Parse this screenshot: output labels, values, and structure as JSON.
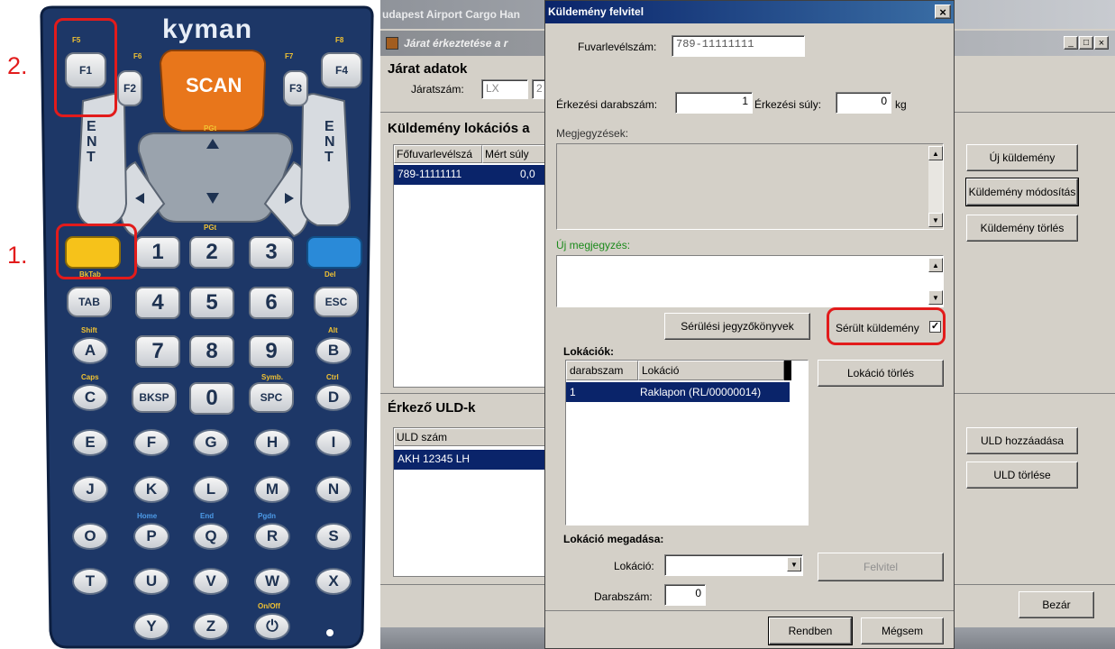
{
  "keypad": {
    "brand": "kyman",
    "annotation_1": "1.",
    "annotation_2": "2.",
    "scan_label": "SCAN",
    "fkeys": {
      "f1": "F1",
      "f2": "F2",
      "f3": "F3",
      "f4": "F4"
    },
    "fkey_small": {
      "f5": "F5",
      "f6": "F6",
      "f7": "F7",
      "f8": "F8"
    },
    "ent_label": "ENT",
    "pg_up": "PGt",
    "pg_down": "PGt",
    "num_rows": [
      [
        "1",
        "2",
        "3"
      ],
      [
        "4",
        "5",
        "6"
      ],
      [
        "7",
        "8",
        "9"
      ]
    ],
    "zero": "0",
    "tab": "TAB",
    "esc": "ESC",
    "bksp": "BKSP",
    "spc": "SPC",
    "small": {
      "bktab": "BkTab",
      "del": "Del",
      "shift": "Shift",
      "alt": "Alt",
      "caps": "Caps",
      "symb": "Symb.",
      "ctrl": "Ctrl",
      "home": "Home",
      "end": "End",
      "pgdn": "Pgdn",
      "onoff": "On/Off"
    },
    "letters": [
      [
        "A",
        "B"
      ],
      [
        "C",
        "D"
      ],
      [
        "E",
        "F",
        "G",
        "H",
        "I"
      ],
      [
        "J",
        "K",
        "L",
        "M",
        "N"
      ],
      [
        "O",
        "P",
        "Q",
        "R",
        "S"
      ],
      [
        "T",
        "U",
        "V",
        "W",
        "X"
      ],
      [
        "Y",
        "Z"
      ]
    ],
    "power": "⏻"
  },
  "colors": {
    "accent_orange": "#e8761b",
    "key_yellow": "#f6c21a",
    "key_blue": "#2a8ad8",
    "body_navy": "#1d3767",
    "selection": "#0a246a",
    "annotation_red": "#e21b1b"
  },
  "bg_window": {
    "taskbar_title": "udapest Airport Cargo Han",
    "title": "Járat érkeztetése a r",
    "section_flight": "Járat adatok",
    "flight_no_label": "Járatszám:",
    "flight_no_value": "LX",
    "flight_no_value2": "2",
    "section_locations": "Küldemény lokációs a",
    "table_headers": [
      "Főfuvarlevélszá",
      "Mért súly"
    ],
    "table_row": [
      "789-11111111",
      "0,0"
    ],
    "section_uld": "Érkező ULD-k",
    "uld_header": "ULD szám",
    "uld_row": "AKH 12345 LH",
    "btn_new": "Új küldemény",
    "btn_modify": "Küldemény módosítás",
    "btn_delete": "Küldemény törlés",
    "btn_uld_add": "ULD hozzáadása",
    "btn_uld_delete": "ULD törlése",
    "btn_close": "Bezár",
    "window_controls": [
      "_",
      "□",
      "×"
    ]
  },
  "dialog": {
    "title": "Küldemény felvitel",
    "close": "×",
    "awb_label": "Fuvarlevélszám:",
    "awb_value": "789-11111111",
    "count_label": "Érkezési darabszám:",
    "count_value": "1",
    "weight_label": "Érkezési súly:",
    "weight_value": "0",
    "weight_unit": "kg",
    "notes_label": "Megjegyzések:",
    "new_note_label": "Új megjegyzés:",
    "btn_damage_report": "Sérülési jegyzőkönyvek",
    "damaged_label": "Sérült küldemény",
    "damaged_checked": "✓",
    "locations_label": "Lokációk:",
    "loc_headers": [
      "darabszam",
      "Lokáció"
    ],
    "loc_row": [
      "1",
      "Raklapon (RL/00000014)"
    ],
    "btn_loc_delete": "Lokáció törlés",
    "loc_input_section": "Lokáció megadása:",
    "loc_field_label": "Lokáció:",
    "loc_field_value": "",
    "btn_add": "Felvitel",
    "qty_label": "Darabszám:",
    "qty_value": "0",
    "btn_ok": "Rendben",
    "btn_cancel": "Mégsem"
  }
}
